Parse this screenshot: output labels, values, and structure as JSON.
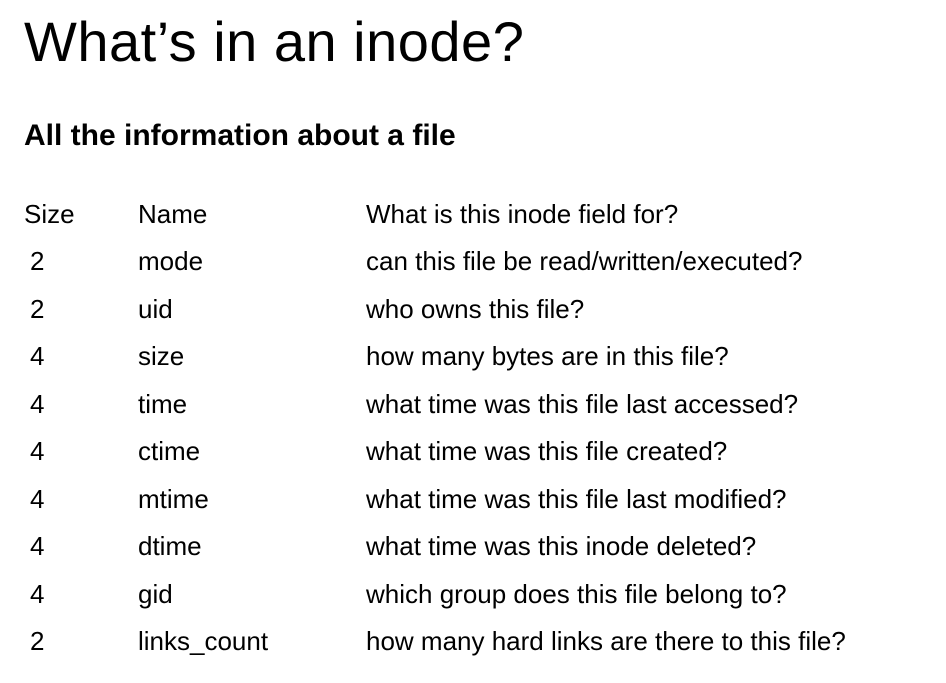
{
  "slide": {
    "title": "What’s in an inode?",
    "subtitle": "All the information about a file"
  },
  "table": {
    "headers": {
      "size": "Size",
      "name": "Name",
      "description": "What is this inode field for?"
    },
    "rows": [
      {
        "size": "2",
        "name": "mode",
        "description": "can this file be read/written/executed?"
      },
      {
        "size": "2",
        "name": "uid",
        "description": "who owns this file?"
      },
      {
        "size": "4",
        "name": "size",
        "description": "how many bytes are in this file?"
      },
      {
        "size": "4",
        "name": "time",
        "description": "what time was this file last accessed?"
      },
      {
        "size": "4",
        "name": "ctime",
        "description": "what time was this file created?"
      },
      {
        "size": "4",
        "name": "mtime",
        "description": "what time was this file last modified?"
      },
      {
        "size": "4",
        "name": "dtime",
        "description": "what time was this inode deleted?"
      },
      {
        "size": "4",
        "name": "gid",
        "description": "which group does this file belong to?"
      },
      {
        "size": "2",
        "name": "links_count",
        "description": "how many hard links are there to this file?"
      }
    ]
  }
}
